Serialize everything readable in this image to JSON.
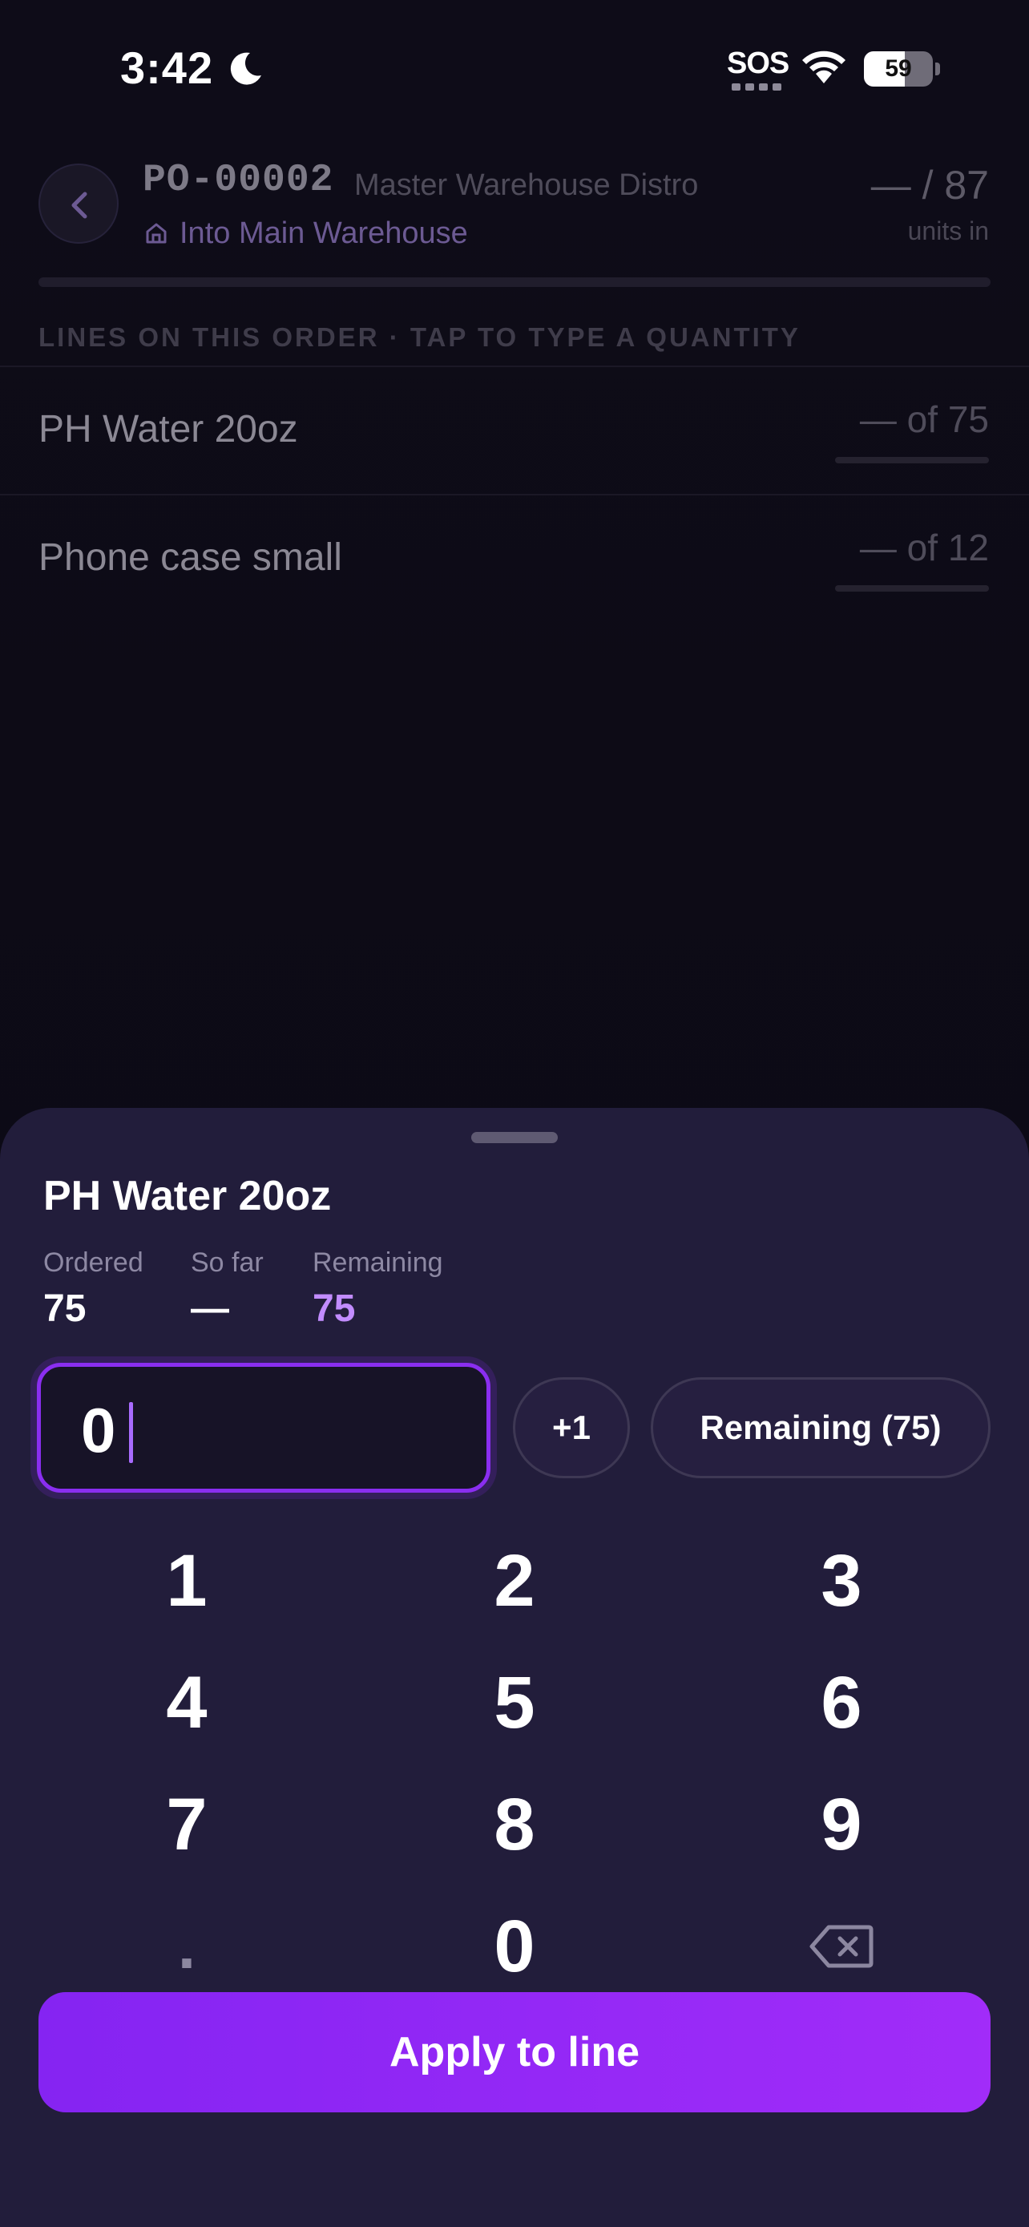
{
  "status_bar": {
    "time": "3:42",
    "sos": "SOS",
    "battery_level": "59",
    "battery_fraction": 0.59
  },
  "order": {
    "po_number": "PO-00002",
    "supplier": "Master Warehouse Distro",
    "destination": "Into Main Warehouse",
    "units_count": "— / 87",
    "units_label": "units in",
    "section_label": "LINES ON THIS ORDER · TAP TO TYPE A QUANTITY",
    "lines": [
      {
        "name": "PH Water 20oz",
        "qty": "— of 75"
      },
      {
        "name": "Phone case small",
        "qty": "— of 12"
      }
    ]
  },
  "sheet": {
    "title": "PH Water 20oz",
    "stats": {
      "ordered_label": "Ordered",
      "ordered_value": "75",
      "so_far_label": "So far",
      "so_far_value": "—",
      "remaining_label": "Remaining",
      "remaining_value": "75"
    },
    "quantity_value": "0",
    "plus_one_label": "+1",
    "remaining_button_label": "Remaining (75)",
    "keypad": {
      "k1": "1",
      "k2": "2",
      "k3": "3",
      "k4": "4",
      "k5": "5",
      "k6": "6",
      "k7": "7",
      "k8": "8",
      "k9": "9",
      "dot": ".",
      "k0": "0",
      "backspace_icon": "backspace-icon"
    },
    "apply_label": "Apply to line"
  },
  "colors": {
    "accent": "#a12cf9",
    "accent_text": "#c28cff",
    "sheet_bg": "#221d3b",
    "page_bg": "#0d0b17"
  },
  "icons": [
    "moon-icon",
    "wifi-icon",
    "battery-icon",
    "chevron-left-icon",
    "warehouse-icon",
    "backspace-icon"
  ]
}
